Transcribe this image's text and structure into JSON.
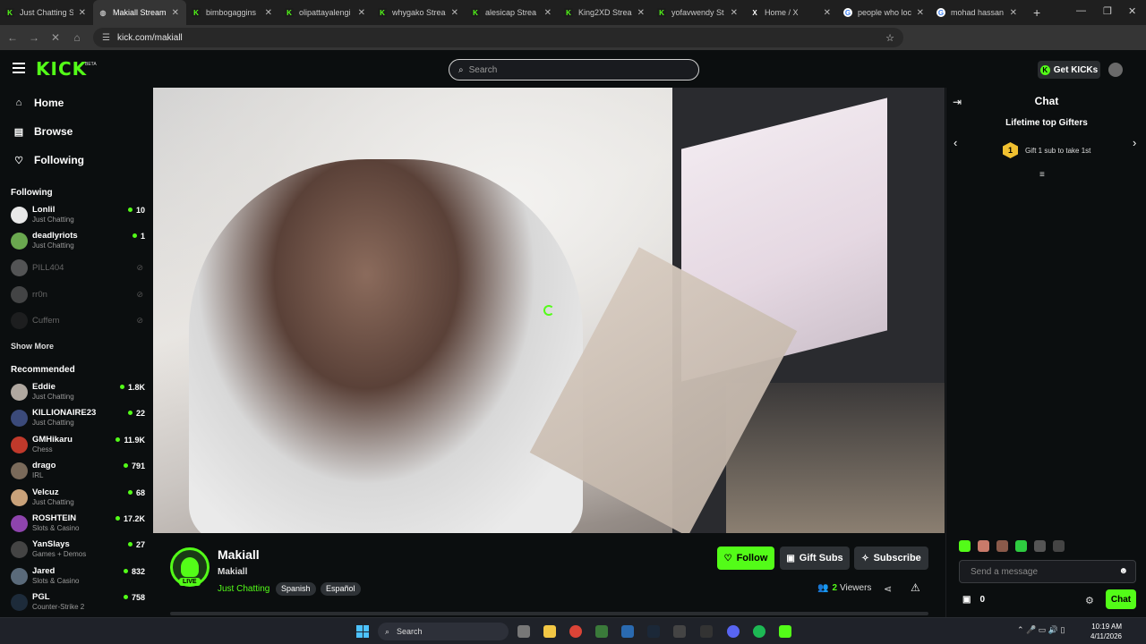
{
  "browser": {
    "tabs": [
      {
        "label": "Just Chatting S",
        "fav": "kick",
        "active": false
      },
      {
        "label": "Makiall Stream",
        "fav": "web",
        "active": true
      },
      {
        "label": "bimbogaggins",
        "fav": "kick",
        "active": false
      },
      {
        "label": "olipattayalengi",
        "fav": "kick",
        "active": false
      },
      {
        "label": "whygako Strea",
        "fav": "kick",
        "active": false
      },
      {
        "label": "alesicap Strea",
        "fav": "kick",
        "active": false
      },
      {
        "label": "King2XD Strea",
        "fav": "kick",
        "active": false
      },
      {
        "label": "yofavwendy St",
        "fav": "kick",
        "active": false
      },
      {
        "label": "Home / X",
        "fav": "x",
        "active": false
      },
      {
        "label": "people who loc",
        "fav": "g",
        "active": false
      },
      {
        "label": "mohad hassan",
        "fav": "g",
        "active": false
      }
    ],
    "url": "kick.com/makiall",
    "icons": [
      "back-icon",
      "forward-icon",
      "reload-icon",
      "home-icon",
      "star-icon",
      "new-tab-icon"
    ]
  },
  "header": {
    "logo": "KICK",
    "beta": "BETA",
    "search_placeholder": "Search",
    "get_kicks": "Get KICKs"
  },
  "sidebar": {
    "nav": [
      {
        "label": "Home",
        "icon": "home-icon"
      },
      {
        "label": "Browse",
        "icon": "browse-icon"
      },
      {
        "label": "Following",
        "icon": "heart-icon"
      }
    ],
    "following_title": "Following",
    "following": [
      {
        "name": "Lonlil",
        "category": "Just Chatting",
        "viewers": "10",
        "avatar": "#e8e8e8"
      },
      {
        "name": "deadlyriots",
        "category": "Just Chatting",
        "viewers": "1",
        "avatar": "#6aa84f"
      }
    ],
    "offline": [
      {
        "name": "PILL404",
        "avatar": "#aaaaaa"
      },
      {
        "name": "rr0n",
        "avatar": "#888888"
      },
      {
        "name": "Cuffem",
        "avatar": "#333333"
      }
    ],
    "show_more": "Show More",
    "recommended_title": "Recommended",
    "recommended": [
      {
        "name": "Eddie",
        "category": "Just Chatting",
        "viewers": "1.8K",
        "avatar": "#b0a8a0"
      },
      {
        "name": "KILLIONAIRE23",
        "category": "Just Chatting",
        "viewers": "22",
        "avatar": "#3b4a7a"
      },
      {
        "name": "GMHikaru",
        "category": "Chess",
        "viewers": "11.9K",
        "avatar": "#c0392b"
      },
      {
        "name": "drago",
        "category": "IRL",
        "viewers": "791",
        "avatar": "#7a6a5a"
      },
      {
        "name": "Velcuz",
        "category": "Just Chatting",
        "viewers": "68",
        "avatar": "#c9a27a"
      },
      {
        "name": "ROSHTEIN",
        "category": "Slots & Casino",
        "viewers": "17.2K",
        "avatar": "#8e44ad"
      },
      {
        "name": "YanSlays",
        "category": "Games + Demos",
        "viewers": "27",
        "avatar": "#444444"
      },
      {
        "name": "Jared",
        "category": "Slots & Casino",
        "viewers": "832",
        "avatar": "#5a6a7a"
      },
      {
        "name": "PGL",
        "category": "Counter-Strike 2",
        "viewers": "758",
        "avatar": "#1d2b3a"
      }
    ]
  },
  "stream": {
    "channel_name": "Makiall",
    "username": "Makiall",
    "category": "Just Chatting",
    "tags": [
      "Spanish",
      "Español"
    ],
    "live_badge": "LIVE",
    "follow": "Follow",
    "gift_subs": "Gift Subs",
    "subscribe": "Subscribe",
    "viewers_count": "2",
    "viewers_label": "Viewers"
  },
  "chat": {
    "title": "Chat",
    "gifters_title": "Lifetime top Gifters",
    "gift_rank": "1",
    "gift_text": "Gift 1 sub to take 1st",
    "message_placeholder": "Send a message",
    "kicks_count": "0",
    "chat_button": "Chat"
  },
  "taskbar": {
    "search": "Search",
    "time": "10:19 AM",
    "date": "4/11/2026"
  },
  "colors": {
    "accent": "#53fc18",
    "background": "#0b0e0f",
    "button_dark": "#2e3236"
  }
}
